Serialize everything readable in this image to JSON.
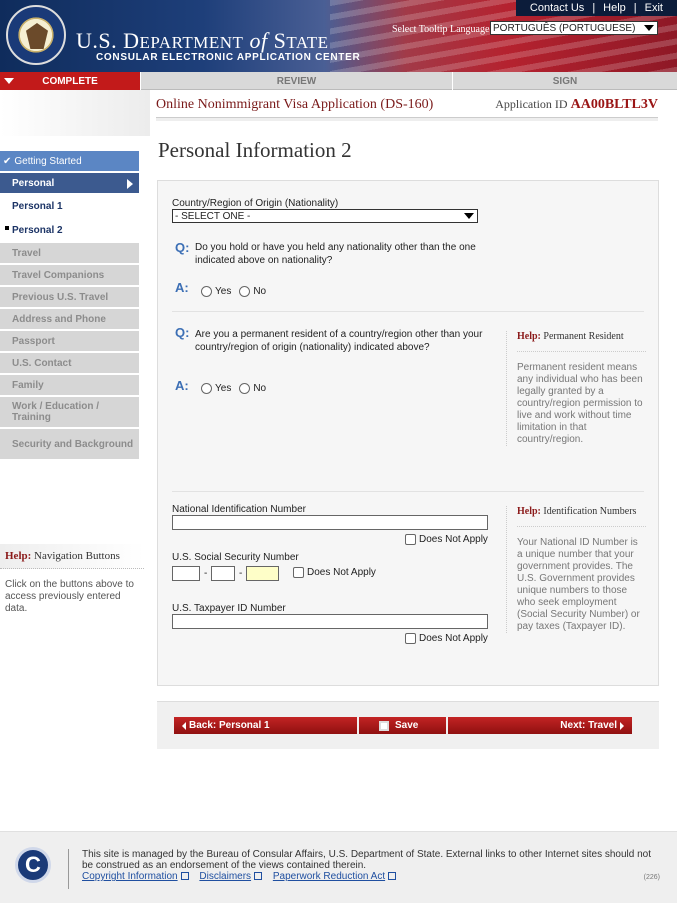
{
  "header": {
    "top_links": [
      "Contact Us",
      "Help",
      "Exit"
    ],
    "title_main": "U.S. DEPARTMENT",
    "title_of": "of",
    "title_state": "STATE",
    "subtitle": "CONSULAR ELECTRONIC APPLICATION CENTER",
    "lang_label": "Select Tooltip Language",
    "lang_value": "PORTUGUÊS (PORTUGUESE)"
  },
  "progress": {
    "complete": "COMPLETE",
    "review": "REVIEW",
    "sign": "SIGN"
  },
  "form": {
    "title": "Online Nonimmigrant Visa Application (DS-160)",
    "app_id_label": "Application ID",
    "app_id": "AA00BLTL3V"
  },
  "sidebar": {
    "started": "Getting Started",
    "personal": "Personal",
    "personal1": "Personal 1",
    "personal2": "Personal 2",
    "travel": "Travel",
    "companions": "Travel Companions",
    "previous": "Previous U.S. Travel",
    "address": "Address and Phone",
    "passport": "Passport",
    "contact": "U.S. Contact",
    "family": "Family",
    "work": "Work / Education / Training",
    "security": "Security and Background"
  },
  "nav_help": {
    "label": "Help:",
    "title": "Navigation Buttons",
    "text": "Click on the buttons above to access previously entered data."
  },
  "page_title": "Personal Information 2",
  "fields": {
    "nationality_label": "Country/Region of Origin (Nationality)",
    "nationality_value": "- SELECT ONE -",
    "q_marker": "Q:",
    "a_marker": "A:",
    "q1": "Do you hold or have you held any nationality other than the one indicated above on nationality?",
    "q2": "Are you a permanent resident of a country/region other than your country/region of origin (nationality) indicated above?",
    "yes": "Yes",
    "no": "No",
    "nin_label": "National Identification Number",
    "ssn_label": "U.S. Social Security Number",
    "tin_label": "U.S. Taxpayer ID Number",
    "does_not_apply": "Does Not Apply",
    "dash": "-"
  },
  "help_pr": {
    "label": "Help:",
    "title": "Permanent Resident",
    "text": "Permanent resident means any individual who has been legally granted by a country/region permission to live and work without time limitation in that country/region."
  },
  "help_id": {
    "label": "Help:",
    "title": "Identification Numbers",
    "text": "Your National ID Number is a unique number that your government provides. The U.S. Government provides unique numbers to those who seek employment (Social Security Number) or pay taxes (Taxpayer ID)."
  },
  "buttons": {
    "back": "Back: Personal 1",
    "save": "Save",
    "next": "Next: Travel"
  },
  "footer": {
    "logo": "C",
    "text": "This site is managed by the Bureau of Consular Affairs, U.S. Department of State. External links to other Internet sites should not be construed as an endorsement of the views contained therein.",
    "links": [
      "Copyright Information",
      "Disclaimers",
      "Paperwork Reduction Act"
    ],
    "code": "(226)"
  },
  "colors": {
    "brand_red": "#c21a1a",
    "brand_blue": "#1a3a78",
    "nav_active": "#3c5a8f",
    "q_blue": "#3c6fb5",
    "help_red": "#8b1a1a"
  }
}
